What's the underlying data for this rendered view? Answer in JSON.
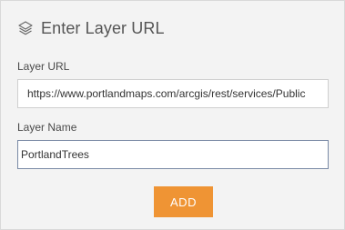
{
  "dialog": {
    "title": "Enter Layer URL",
    "icon": "layers-icon"
  },
  "layer_url": {
    "label": "Layer URL",
    "value": "https://www.portlandmaps.com/arcgis/rest/services/Publiс"
  },
  "layer_name": {
    "label": "Layer Name",
    "value": "PortlandTrees"
  },
  "actions": {
    "add_label": "ADD",
    "add_color": "#ef9434"
  }
}
